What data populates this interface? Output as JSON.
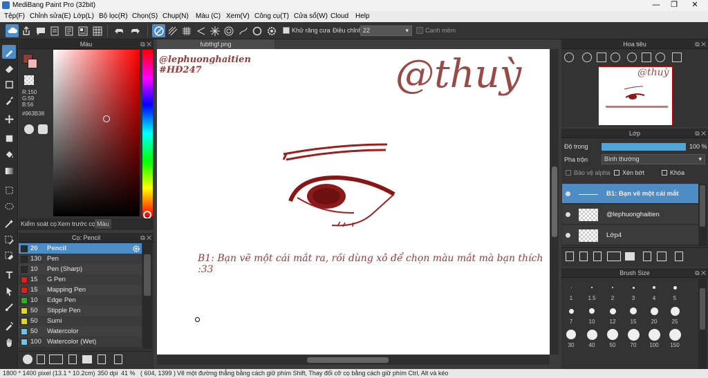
{
  "window": {
    "title": "MediBang Paint Pro (32bit)",
    "min": "—",
    "max": "❐",
    "close": "✕"
  },
  "menu": [
    "Tệp(F)",
    "Chỉnh sửa(E)",
    "Lớp(L)",
    "Bộ lọc(R)",
    "Chọn(S)",
    "Chụp(N)",
    "Màu (C)",
    "Xem(V)",
    "Công cụ(T)",
    "Cửa sổ(W)",
    "Cloud",
    "Help"
  ],
  "toolbar": {
    "antialias_label": "Khử răng cưa",
    "correction_label": "Điều chỉnh",
    "correction_value": "22",
    "edge_label": "Cạnh mềm"
  },
  "color_panel": {
    "title": "Màu",
    "r": "R:150",
    "g": "G:59",
    "b": "B:56",
    "hex": "#963B38",
    "tabs": [
      "Kiểm soát cọ",
      "Xem trước cọ",
      "Màu"
    ]
  },
  "brush_panel": {
    "title": "Cọ: Pencil",
    "items": [
      {
        "size": "20",
        "name": "Pencil",
        "color": "#2b2b2b"
      },
      {
        "size": "130",
        "name": "Pen",
        "color": "#2b2b2b"
      },
      {
        "size": "10",
        "name": "Pen (Sharp)",
        "color": "#2b2b2b"
      },
      {
        "size": "15",
        "name": "G Pen",
        "color": "#e0201e"
      },
      {
        "size": "15",
        "name": "Mapping Pen",
        "color": "#e0201e"
      },
      {
        "size": "10",
        "name": "Edge Pen",
        "color": "#27b027"
      },
      {
        "size": "50",
        "name": "Stipple Pen",
        "color": "#e6d51a"
      },
      {
        "size": "50",
        "name": "Sumi",
        "color": "#e6d51a"
      },
      {
        "size": "50",
        "name": "Watercolor",
        "color": "#69c7f0"
      },
      {
        "size": "100",
        "name": "Watercolor (Wet)",
        "color": "#69c7f0"
      }
    ]
  },
  "document": {
    "tab": "fubthgf.png",
    "credit_line1": "@lephuonghaitien",
    "credit_line2": "#HĐ247",
    "signature": "@thuỳ",
    "instruction": "B1: Bạn vẽ một cái mắt ra, rồi dùng xô để chọn màu mắt mà bạn thích :33"
  },
  "navigator": {
    "title": "Hoa tiêu"
  },
  "layer_panel": {
    "title": "Lớp",
    "opacity_label": "Độ trong",
    "opacity_value": "100 %",
    "opacity": 1.0,
    "blend_label": "Pha trộn",
    "blend_value": "Bình thường",
    "protect_alpha": "Bảo vệ alpha",
    "clipping": "Xén bớt",
    "lock": "Khóa",
    "layers": [
      {
        "name": "B1: Bạn vẽ một cái mắt"
      },
      {
        "name": "@lephuonghaitien"
      },
      {
        "name": "Lớp4"
      }
    ]
  },
  "brush_size_panel": {
    "title": "Brush Size",
    "sizes": [
      "1",
      "1.5",
      "2",
      "3",
      "4",
      "5",
      "7",
      "10",
      "12",
      "15",
      "20",
      "25",
      "30",
      "40",
      "50",
      "70",
      "100",
      "150"
    ]
  },
  "status": {
    "dims": "1800 * 1400 pixel",
    "cm": "(13.1 * 10.2cm)",
    "dpi": "350 dpi",
    "zoom": "41 %",
    "coords": "( 604, 1399 )",
    "hint": "Vẽ một đường thẳng bằng cách giữ phím Shift, Thay đổi cỡ cọ bằng cách giữ phím Ctrl, Alt và kéo"
  },
  "colors": {
    "primary": "#963B38",
    "accent": "#4e8cc5"
  }
}
